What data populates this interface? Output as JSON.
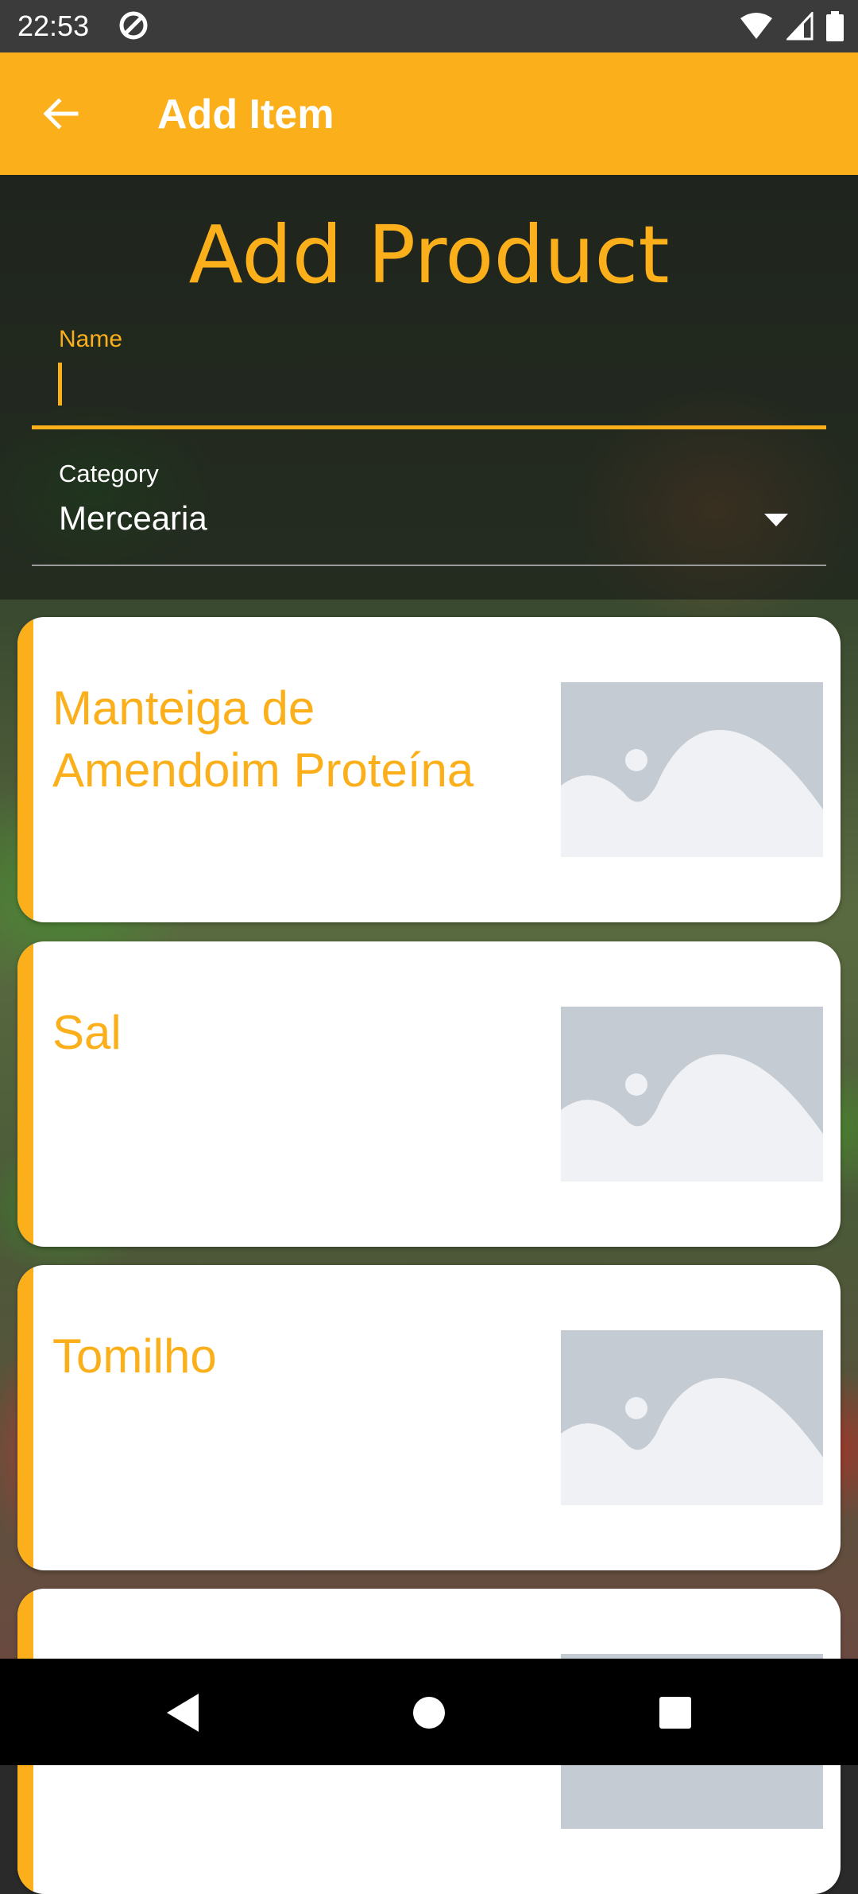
{
  "status_bar": {
    "time": "22:53",
    "icons": [
      "sync-icon",
      "wifi-icon",
      "signal-icon",
      "battery-icon"
    ]
  },
  "app_bar": {
    "title": "Add Item",
    "back_icon": "arrow-left-icon"
  },
  "form": {
    "title": "Add Product",
    "name_label": "Name",
    "name_value": "",
    "category_label": "Category",
    "category_value": "Mercearia"
  },
  "products": [
    {
      "name": "Manteiga de Amendoim Proteína",
      "image": "image-placeholder-icon"
    },
    {
      "name": "Sal",
      "image": "image-placeholder-icon"
    },
    {
      "name": "Tomilho",
      "image": "image-placeholder-icon"
    },
    {
      "name": "",
      "image": "image-placeholder-icon"
    }
  ],
  "nav_bar": {
    "buttons": [
      "back-triangle-icon",
      "home-circle-icon",
      "recents-square-icon"
    ]
  },
  "colors": {
    "accent": "#fbb01b",
    "card": "#ffffff",
    "status_bar": "#3b3b3b",
    "nav_bar": "#000000"
  }
}
